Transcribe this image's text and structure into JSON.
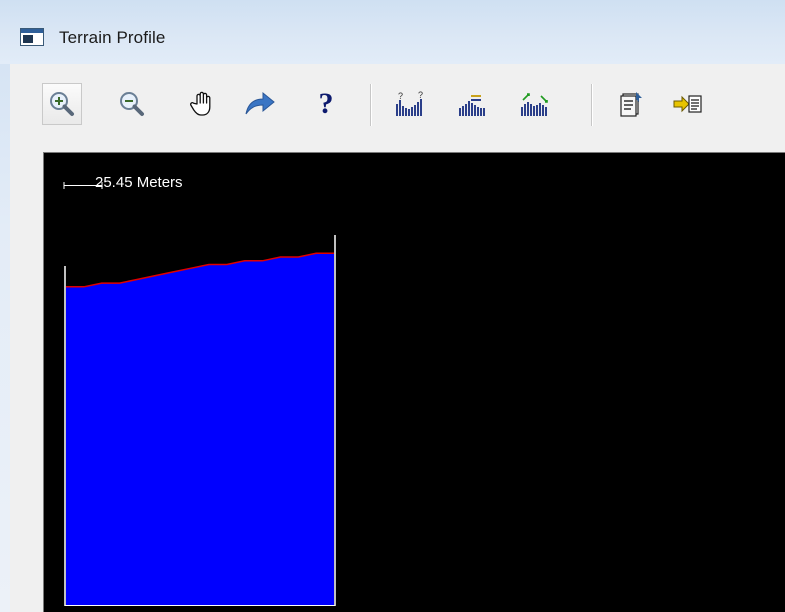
{
  "window": {
    "title": "Terrain Profile",
    "icon": "application-window-icon"
  },
  "toolbar": {
    "buttons": [
      {
        "name": "zoom-in",
        "icon": "zoom-in-icon",
        "active": true
      },
      {
        "name": "zoom-out",
        "icon": "zoom-out-icon",
        "active": false
      },
      {
        "name": "pan",
        "icon": "hand-icon",
        "active": false
      },
      {
        "name": "forward",
        "icon": "arrow-right-icon",
        "active": false
      },
      {
        "name": "help",
        "icon": "question-icon",
        "label": "?",
        "active": false
      },
      {
        "name": "profile-options",
        "icon": "profile-bars-icon",
        "active": false
      },
      {
        "name": "profile-level",
        "icon": "profile-level-icon",
        "active": false
      },
      {
        "name": "profile-slope",
        "icon": "profile-slope-icon",
        "active": false
      },
      {
        "name": "properties",
        "icon": "properties-icon",
        "active": false
      },
      {
        "name": "export",
        "icon": "export-icon",
        "active": false
      }
    ]
  },
  "profile": {
    "scale_bar_label": "25.45 Meters",
    "colors": {
      "background": "#000000",
      "fill": "#0000ff",
      "outline": "#e00000",
      "frame": "#ffffff"
    },
    "surface_elevation_fraction": [
      0.85,
      0.85,
      0.86,
      0.86,
      0.87,
      0.88,
      0.89,
      0.9,
      0.91,
      0.91,
      0.92,
      0.92,
      0.93,
      0.93,
      0.94,
      0.94
    ]
  }
}
